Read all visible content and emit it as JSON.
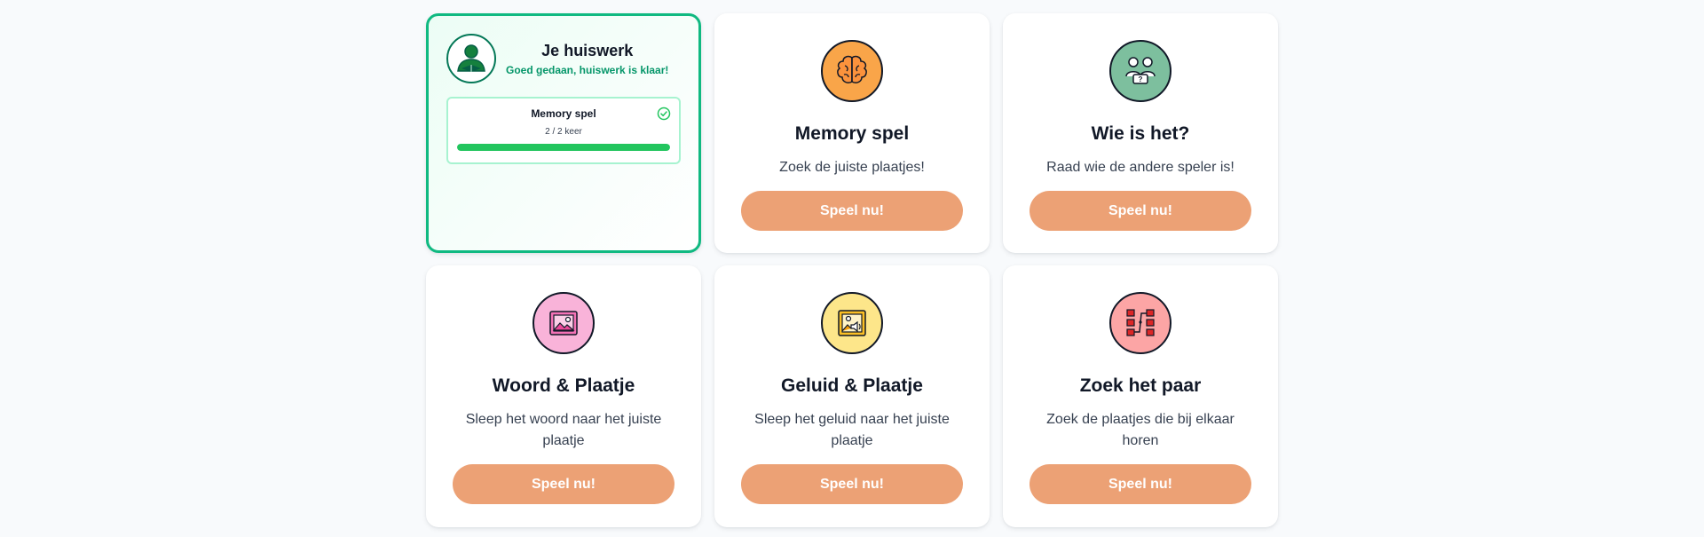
{
  "homework": {
    "title": "Je huiswerk",
    "status": "Goed gedaan, huiswerk is klaar!",
    "avatar_icon": "student-icon",
    "task": {
      "name": "Memory spel",
      "count": "2 / 2 keer",
      "progress": 1.0,
      "status_icon": "check-circle-icon"
    }
  },
  "games": [
    {
      "title": "Memory spel",
      "description": "Zoek de juiste plaatjes!",
      "button": "Speel nu!",
      "icon": "brain-icon",
      "icon_color": "#f9a549"
    },
    {
      "title": "Wie is het?",
      "description": "Raad wie de andere speler is!",
      "button": "Speel nu!",
      "icon": "people-guess-icon",
      "icon_color": "#7dbf9e"
    },
    {
      "title": "Woord & Plaatje",
      "description": "Sleep het woord naar het juiste plaatje",
      "button": "Speel nu!",
      "icon": "picture-icon",
      "icon_color": "#f9b3d9"
    },
    {
      "title": "Geluid & Plaatje",
      "description": "Sleep het geluid naar het juiste plaatje",
      "button": "Speel nu!",
      "icon": "sound-picture-icon",
      "icon_color": "#fde68a"
    },
    {
      "title": "Zoek het paar",
      "description": "Zoek de plaatjes die bij elkaar horen",
      "button": "Speel nu!",
      "icon": "match-pairs-icon",
      "icon_color": "#fca5a5"
    }
  ],
  "colors": {
    "accent_button": "#eca175",
    "success": "#10b981",
    "progress": "#22c55e"
  }
}
